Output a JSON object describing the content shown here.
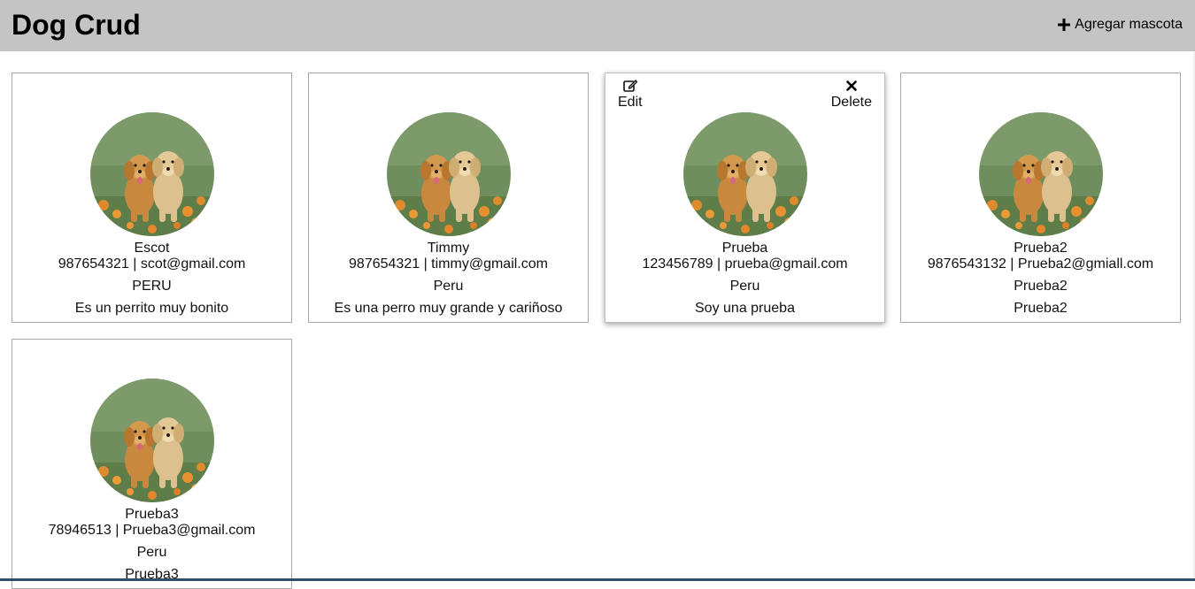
{
  "header": {
    "title": "Dog Crud",
    "add_label": "Agregar mascota",
    "add_icon": "plus-icon",
    "background": "#c4c4c4"
  },
  "card_actions": {
    "edit_label": "Edit",
    "edit_icon": "edit-icon",
    "delete_label": "Delete",
    "delete_icon": "close-icon"
  },
  "pets": [
    {
      "name": "Escot",
      "phone": "987654321",
      "email": "scot@gmail.com",
      "contact": "987654321 | scot@gmail.com",
      "country": "PERU",
      "description": "Es un perrito muy bonito"
    },
    {
      "name": "Timmy",
      "phone": "987654321",
      "email": "timmy@gmail.com",
      "contact": "987654321 | timmy@gmail.com",
      "country": "Peru",
      "description": "Es una perro muy grande y cariñoso"
    },
    {
      "name": "Prueba",
      "phone": "123456789",
      "email": "prueba@gmail.com",
      "contact": "123456789 | prueba@gmail.com",
      "country": "Peru",
      "description": "Soy una prueba"
    },
    {
      "name": "Prueba2",
      "phone": "9876543132",
      "email": "Prueba2@gmiall.com",
      "contact": "9876543132 | Prueba2@gmiall.com",
      "country": "Prueba2",
      "description": "Prueba2"
    },
    {
      "name": "Prueba3",
      "phone": "78946513",
      "email": "Prueba3@gmail.com",
      "contact": "78946513 | Prueba3@gmail.com",
      "country": "Peru",
      "description": "Prueba3"
    }
  ]
}
